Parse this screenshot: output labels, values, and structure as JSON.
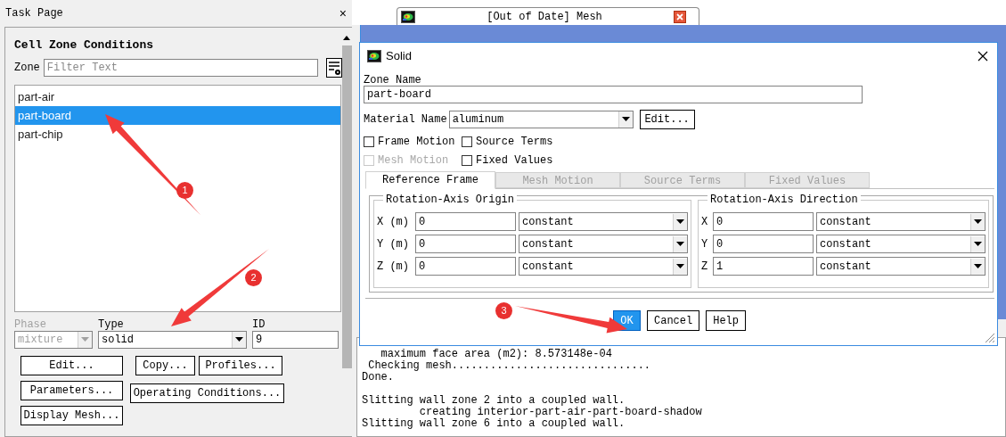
{
  "task_page": {
    "title": "Task Page",
    "close": "×",
    "heading": "Cell Zone Conditions",
    "zone_label": "Zone",
    "filter_placeholder": "Filter Text",
    "zones": [
      {
        "label": "part-air",
        "selected": false
      },
      {
        "label": "part-board",
        "selected": true
      },
      {
        "label": "part-chip",
        "selected": false
      }
    ],
    "phase": {
      "label": "Phase",
      "value": "mixture",
      "disabled": true
    },
    "type": {
      "label": "Type",
      "value": "solid"
    },
    "id": {
      "label": "ID",
      "value": "9"
    },
    "buttons": [
      "Edit...",
      "Copy...",
      "Profiles...",
      "Parameters...",
      "Operating Conditions...",
      "Display Mesh..."
    ]
  },
  "graphics": {
    "tab_title": "[Out of Date] Mesh"
  },
  "dialog": {
    "title": "Solid",
    "zone_name_label": "Zone Name",
    "zone_name": "part-board",
    "material_label": "Material Name",
    "material": "aluminum",
    "edit_button": "Edit...",
    "checkboxes": [
      {
        "label": "Frame Motion",
        "checked": false,
        "disabled": false
      },
      {
        "label": "Source Terms",
        "checked": false,
        "disabled": false
      },
      {
        "label": "Mesh Motion",
        "checked": false,
        "disabled": true
      },
      {
        "label": "Fixed Values",
        "checked": false,
        "disabled": false
      }
    ],
    "tabs": [
      {
        "label": "Reference Frame",
        "selected": true,
        "disabled": false
      },
      {
        "label": "Mesh Motion",
        "selected": false,
        "disabled": true
      },
      {
        "label": "Source Terms",
        "selected": false,
        "disabled": true
      },
      {
        "label": "Fixed Values",
        "selected": false,
        "disabled": true
      }
    ],
    "groups": [
      {
        "title": "Rotation-Axis Origin",
        "rows": [
          {
            "label": "X (m)",
            "value": "0",
            "method": "constant"
          },
          {
            "label": "Y (m)",
            "value": "0",
            "method": "constant"
          },
          {
            "label": "Z (m)",
            "value": "0",
            "method": "constant"
          }
        ]
      },
      {
        "title": "Rotation-Axis Direction",
        "rows": [
          {
            "label": "X",
            "value": "0",
            "method": "constant"
          },
          {
            "label": "Y",
            "value": "0",
            "method": "constant"
          },
          {
            "label": "Z",
            "value": "1",
            "method": "constant"
          }
        ]
      }
    ],
    "buttons": [
      {
        "label": "OK",
        "default": true
      },
      {
        "label": "Cancel",
        "default": false
      },
      {
        "label": "Help",
        "default": false
      }
    ]
  },
  "console": {
    "lines": [
      {
        "text": "   maximum face area (m2): 8.573148e-04",
        "blank_before": false
      },
      {
        "text": " Checking mesh...............................",
        "blank_before": false
      },
      {
        "text": "Done.",
        "blank_before": false
      },
      {
        "text": "Slitting wall zone 2 into a coupled wall.",
        "blank_before": true
      },
      {
        "text": "         creating interior-part-air-part-board-shadow",
        "blank_before": false
      },
      {
        "text": "Slitting wall zone 6 into a coupled wall.",
        "blank_before": false
      }
    ]
  },
  "annotations": [
    {
      "number": "1"
    },
    {
      "number": "2"
    },
    {
      "number": "3"
    }
  ]
}
